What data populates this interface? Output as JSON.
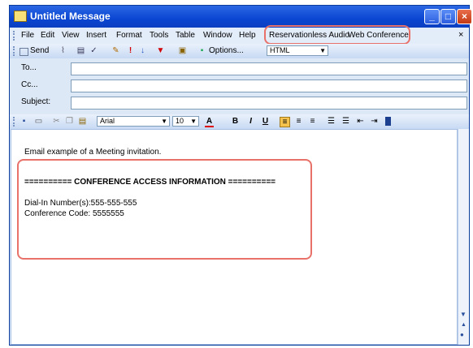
{
  "window": {
    "title": "Untitled Message"
  },
  "menu": {
    "items": [
      "File",
      "Edit",
      "View",
      "Insert",
      "Format",
      "Tools",
      "Table",
      "Window",
      "Help"
    ],
    "plugins": [
      "Reservationless Audio",
      "Web Conference"
    ],
    "close_glyph": "×"
  },
  "toolbar": {
    "send_label": "Send",
    "options_label": "Options...",
    "format_value": "HTML"
  },
  "headers": {
    "to_label": "To...",
    "cc_label": "Cc...",
    "subject_label": "Subject:"
  },
  "formatting": {
    "font": "Arial",
    "size": "10"
  },
  "body": {
    "line1": "Email example of a Meeting invitation.",
    "section_title": "========== CONFERENCE ACCESS INFORMATION ==========",
    "dial_in": "Dial-In Number(s):555-555-555",
    "conference_code": "Conference Code: 5555555"
  },
  "colors": {
    "highlight": "#e8716a",
    "titlebar": "#0a46d2"
  }
}
